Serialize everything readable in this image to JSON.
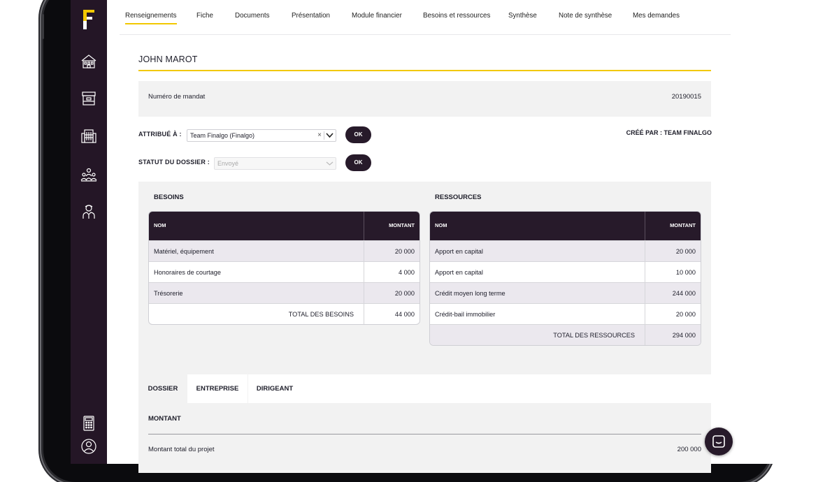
{
  "nav_tabs": [
    {
      "label": "Renseignements",
      "active": true
    },
    {
      "label": "Fiche"
    },
    {
      "label": "Documents"
    },
    {
      "label": "Présentation"
    },
    {
      "label": "Module financier"
    },
    {
      "label": "Besoins et ressources"
    },
    {
      "label": "Synthèse"
    },
    {
      "label": "Note de synthèse"
    },
    {
      "label": "Mes demandes"
    }
  ],
  "sidebar_icons": [
    "home-icon",
    "archive-box-icon",
    "buildings-icon",
    "team-icon",
    "advisor-icon",
    "calculator-icon",
    "user-profile-icon"
  ],
  "client_name": "JOHN MAROT",
  "mandate": {
    "label": "Numéro de mandat",
    "value": "20190015"
  },
  "assigned": {
    "label": "ATTRIBUÉ À :",
    "value": "Team Finalgo (Finalgo)",
    "clear": "×",
    "ok": "OK"
  },
  "status": {
    "label": "STATUT DU DOSSIER :",
    "placeholder": "Envoyé",
    "ok": "OK"
  },
  "created_by": "CRÉÉ PAR : TEAM FINALGO",
  "besoins": {
    "title": "BESOINS",
    "col_name": "NOM",
    "col_amount": "MONTANT",
    "rows": [
      {
        "name": "Matériel, équipement",
        "amount": "20 000"
      },
      {
        "name": "Honoraires de courtage",
        "amount": "4 000"
      },
      {
        "name": "Trésorerie",
        "amount": "20 000"
      }
    ],
    "total_label": "TOTAL DES BESOINS",
    "total": "44 000"
  },
  "ressources": {
    "title": "RESSOURCES",
    "col_name": "NOM",
    "col_amount": "MONTANT",
    "rows": [
      {
        "name": "Apport en capital",
        "amount": "20 000"
      },
      {
        "name": "Apport en capital",
        "amount": "10 000"
      },
      {
        "name": "Crédit moyen long terme",
        "amount": "244 000"
      },
      {
        "name": "Crédit-bail immobilier",
        "amount": "20 000"
      }
    ],
    "total_label": "TOTAL DES RESSOURCES",
    "total": "294 000"
  },
  "sub_tabs": [
    "DOSSIER",
    "ENTREPRISE",
    "DIRIGEANT"
  ],
  "montant": {
    "title": "MONTANT",
    "total_label": "Montant total du projet",
    "total_value": "200 000"
  },
  "colors": {
    "accent": "#f2c800",
    "dark": "#271a2a",
    "sidebar": "#241626"
  }
}
